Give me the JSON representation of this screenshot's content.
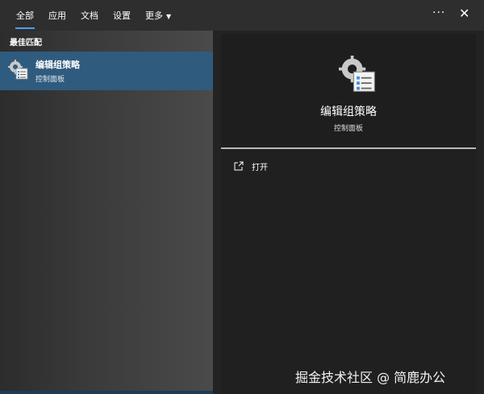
{
  "tabs": [
    {
      "label": "全部",
      "active": true
    },
    {
      "label": "应用"
    },
    {
      "label": "文档"
    },
    {
      "label": "设置"
    },
    {
      "label": "更多"
    }
  ],
  "header": {
    "ellipsis": "···",
    "close": "✕"
  },
  "best_match": {
    "heading": "最佳匹配",
    "item": {
      "title": "编辑组策略",
      "subtitle": "控制面板",
      "icon": "group-policy-icon"
    }
  },
  "preview": {
    "title": "编辑组策略",
    "subtitle": "控制面板",
    "icon": "group-policy-icon",
    "actions": [
      {
        "label": "打开",
        "icon": "open-icon"
      }
    ]
  },
  "watermark": "掘金技术社区 @ 简鹿办公",
  "colors": {
    "accent": "#4ba0e8",
    "selected_bg": "#2f5b7f"
  }
}
